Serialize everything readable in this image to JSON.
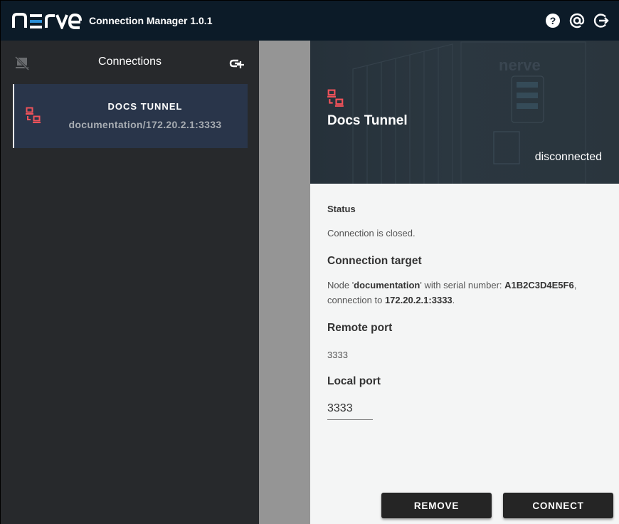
{
  "app": {
    "logo_text": "nerve",
    "title": "Connection Manager 1.0.1",
    "header_icons": [
      "help-icon",
      "contact-at-icon",
      "logout-icon"
    ]
  },
  "sidebar": {
    "title": "Connections",
    "left_icon": "desktop-off-icon",
    "right_icon": "add-link-icon",
    "connections": [
      {
        "name": "DOCS TUNNEL",
        "subtitle": "documentation/172.20.2.1:3333",
        "icon": "network-tunnel-icon",
        "selected": true
      }
    ]
  },
  "detail": {
    "title": "Docs Tunnel",
    "connection_state": "disconnected",
    "status_label": "Status",
    "status_text": "Connection is closed.",
    "target_label": "Connection target",
    "target": {
      "prefix": "Node '",
      "node": "documentation",
      "mid": "' with serial number: ",
      "serial": "A1B2C3D4E5F6",
      "sep": ",",
      "conn_prefix": "connection to ",
      "address": "172.20.2.1:3333",
      "end": "."
    },
    "remote_port_label": "Remote port",
    "remote_port": "3333",
    "local_port_label": "Local port",
    "local_port": "3333",
    "buttons": {
      "remove": "REMOVE",
      "connect": "CONNECT"
    }
  },
  "colors": {
    "accent_red": "#f0525a",
    "brand_blue": "#2b8fd6",
    "topbar": "#0c1b28",
    "sidebar": "#27292c",
    "selected_item": "#29354a"
  }
}
